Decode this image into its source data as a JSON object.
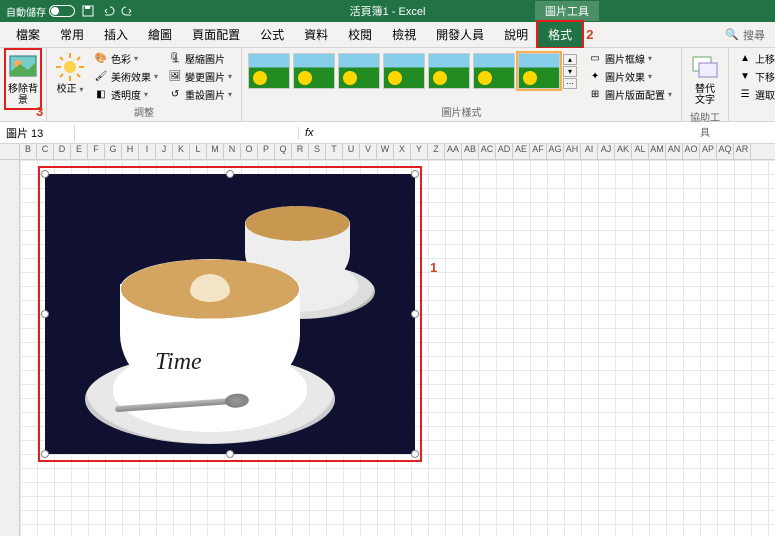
{
  "titlebar": {
    "autosave_label": "自動儲存",
    "autosave_state": "關閉",
    "doc_title": "活頁簿1 - Excel",
    "context_tab": "圖片工具"
  },
  "tabs": {
    "file": "檔案",
    "home": "常用",
    "insert": "插入",
    "draw": "繪圖",
    "layout": "頁面配置",
    "formulas": "公式",
    "data": "資料",
    "review": "校閱",
    "view": "檢視",
    "developer": "開發人員",
    "help": "說明",
    "format": "格式",
    "search": "搜尋"
  },
  "ribbon": {
    "remove_bg": "移除背景",
    "corrections": "校正",
    "color": "色彩",
    "artistic": "美術效果",
    "transparency": "透明度",
    "compress": "壓縮圖片",
    "change": "變更圖片",
    "reset": "重設圖片",
    "adjust_group": "調整",
    "styles_group": "圖片樣式",
    "border": "圖片框線",
    "effects": "圖片效果",
    "layout_pic": "圖片版面配置",
    "alt_text": "替代\n文字",
    "acc_group": "協助工具",
    "bring_fwd": "上移一",
    "send_back": "下移一",
    "selection": "選取範圍"
  },
  "namebox": {
    "value": "圖片 13"
  },
  "formula": {
    "fx": "fx"
  },
  "callouts": {
    "c1": "1",
    "c2": "2",
    "c3": "3"
  },
  "columns": [
    "",
    "B",
    "C",
    "D",
    "E",
    "F",
    "G",
    "H",
    "I",
    "J",
    "K",
    "L",
    "M",
    "N",
    "O",
    "P",
    "Q",
    "R",
    "S",
    "T",
    "U",
    "V",
    "W",
    "X",
    "Y",
    "Z",
    "AA",
    "AB",
    "AC",
    "AD",
    "AE",
    "AF",
    "AG",
    "AH",
    "AI",
    "AJ",
    "AK",
    "AL",
    "AM",
    "AN",
    "AO",
    "AP",
    "AQ",
    "AR"
  ],
  "pic_text": "Time"
}
